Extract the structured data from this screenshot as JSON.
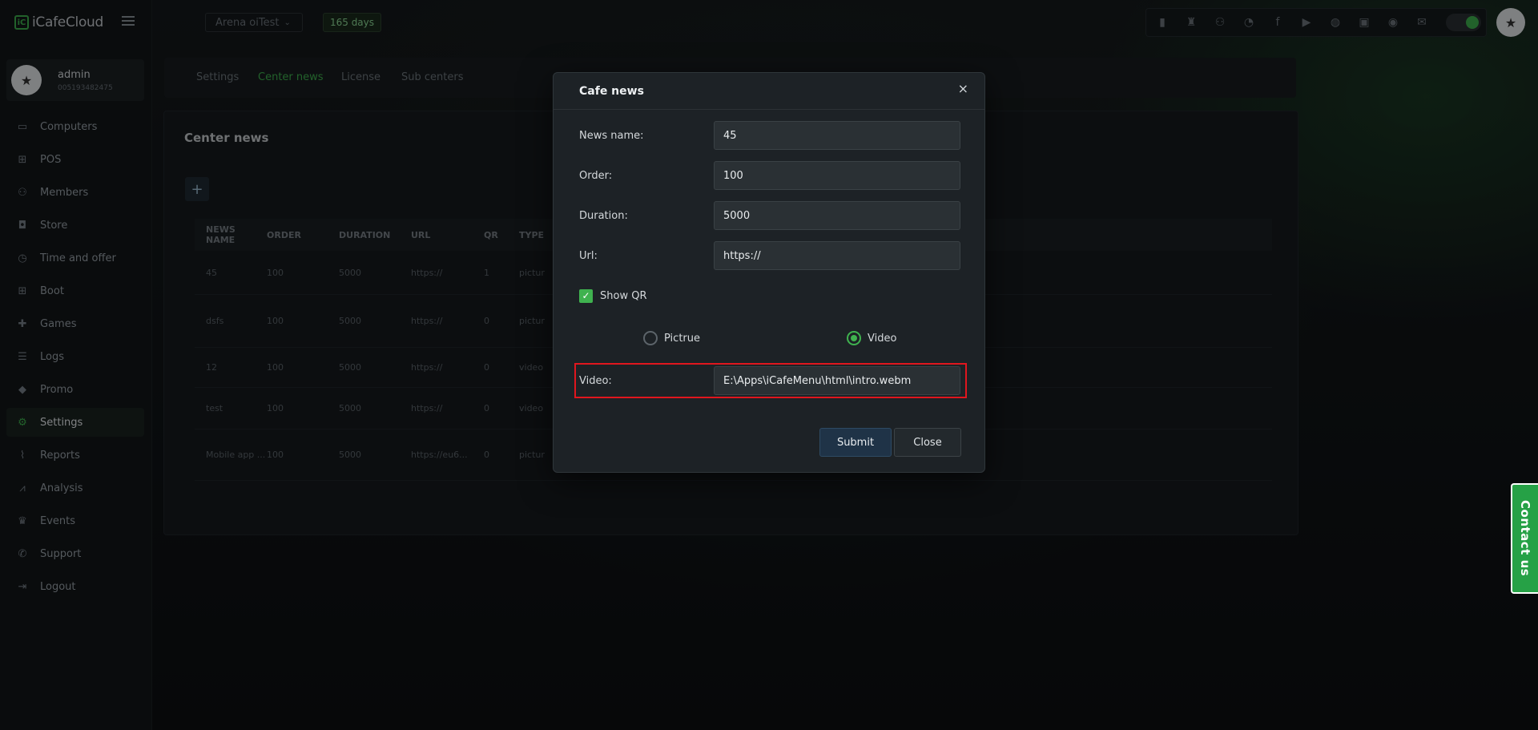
{
  "app": {
    "logo_text": "iCafeCloud"
  },
  "user": {
    "name": "admin",
    "id": "005193482475"
  },
  "sidebar": {
    "items": [
      {
        "label": "Computers",
        "icon": "monitor-icon"
      },
      {
        "label": "POS",
        "icon": "register-icon"
      },
      {
        "label": "Members",
        "icon": "users-icon"
      },
      {
        "label": "Store",
        "icon": "bag-icon"
      },
      {
        "label": "Time and offer",
        "icon": "clock-icon"
      },
      {
        "label": "Boot",
        "icon": "windows-icon"
      },
      {
        "label": "Games",
        "icon": "gamepad-icon"
      },
      {
        "label": "Logs",
        "icon": "list-icon"
      },
      {
        "label": "Promo",
        "icon": "tag-icon"
      },
      {
        "label": "Settings",
        "icon": "gear-icon",
        "active": true
      },
      {
        "label": "Reports",
        "icon": "chart-line-icon"
      },
      {
        "label": "Analysis",
        "icon": "analysis-icon"
      },
      {
        "label": "Events",
        "icon": "crown-icon"
      },
      {
        "label": "Support",
        "icon": "phone-icon"
      },
      {
        "label": "Logout",
        "icon": "logout-icon"
      }
    ]
  },
  "topbar": {
    "center_select": "Arena oiTest",
    "days_badge": "165 days"
  },
  "tabs": [
    "Settings",
    "Center news",
    "License",
    "Sub centers"
  ],
  "panel": {
    "title": "Center news",
    "add_label": "+",
    "columns": [
      "NEWS NAME",
      "ORDER",
      "DURATION",
      "URL",
      "QR",
      "TYPE"
    ],
    "rows": [
      [
        "45",
        "100",
        "5000",
        "https://",
        "1",
        "pictur"
      ],
      [
        "dsfs",
        "100",
        "5000",
        "https://",
        "0",
        "pictur"
      ],
      [
        "12",
        "100",
        "5000",
        "https://",
        "0",
        "video"
      ],
      [
        "test",
        "100",
        "5000",
        "https://",
        "0",
        "video"
      ],
      [
        "Mobile app ...",
        "100",
        "5000",
        "https://eu6...",
        "0",
        "pictur"
      ]
    ]
  },
  "modal": {
    "title": "Cafe news",
    "close_icon": "×",
    "fields": {
      "news_name_label": "News name:",
      "news_name_value": "45",
      "order_label": "Order:",
      "order_value": "100",
      "duration_label": "Duration:",
      "duration_value": "5000",
      "url_label": "Url:",
      "url_value": "https://",
      "show_qr_label": "Show QR",
      "show_qr_checked": true,
      "radio_picture_label": "Pictrue",
      "radio_video_label": "Video",
      "selected_type": "Video",
      "video_label": "Video:",
      "video_value": "E:\\Apps\\iCafeMenu\\html\\intro.webm"
    },
    "submit_label": "Submit",
    "close_label": "Close"
  },
  "contact_us": "Contact us",
  "colors": {
    "accent": "#3fb24f",
    "highlight": "#e0161e"
  }
}
